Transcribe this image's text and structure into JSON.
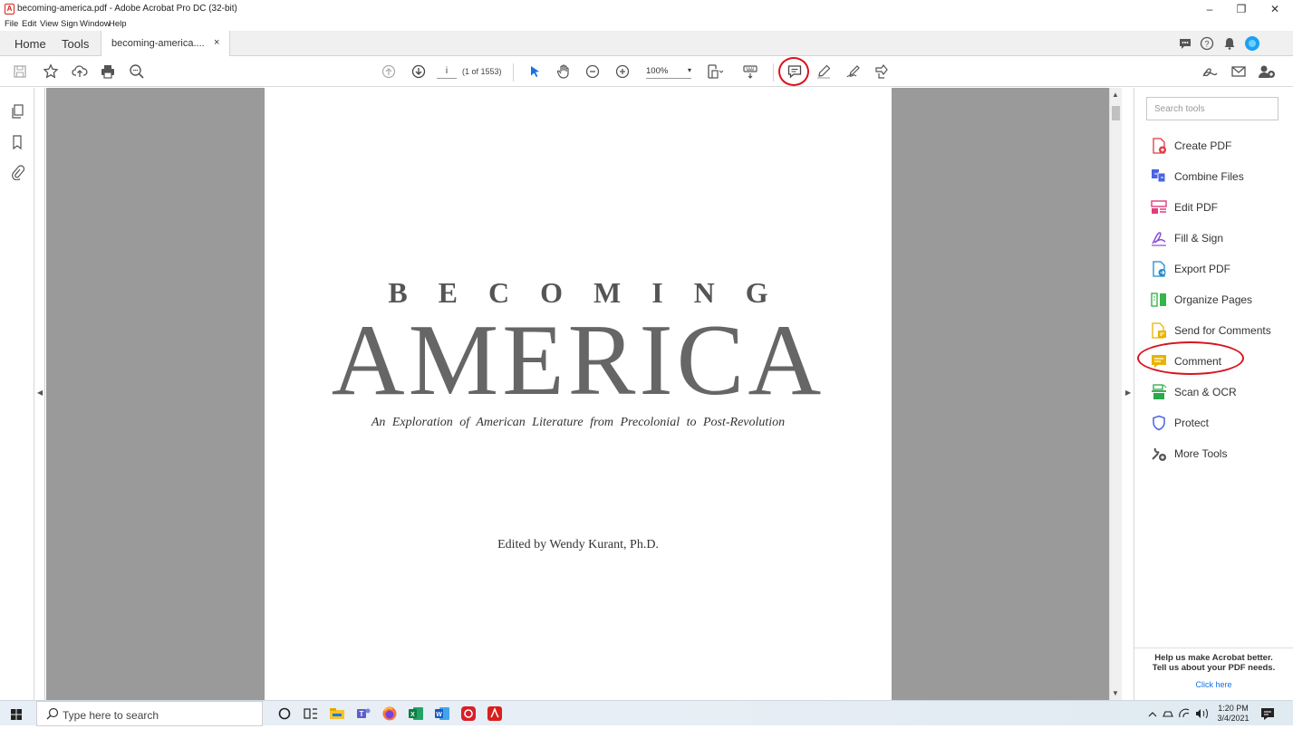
{
  "window": {
    "title": "becoming-america.pdf - Adobe Acrobat Pro DC (32-bit)",
    "controls": {
      "minimize": "–",
      "maximize": "❐",
      "close": "✕"
    }
  },
  "menu": [
    "File",
    "Edit",
    "View",
    "Sign",
    "Window",
    "Help"
  ],
  "tabs": {
    "home": "Home",
    "tools": "Tools",
    "document": "becoming-america....",
    "close": "×"
  },
  "toolbar": {
    "page_value": "i",
    "page_count": "(1 of 1553)",
    "zoom": "100%",
    "zoom_arrow": "▾"
  },
  "document": {
    "line1": "BECOMING",
    "line2": "AMERICA",
    "subtitle": "An Exploration of American Literature from Precolonial to Post-Revolution",
    "editor": "Edited by Wendy Kurant, Ph.D."
  },
  "tools_panel": {
    "search_placeholder": "Search tools",
    "items": [
      {
        "label": "Create PDF",
        "color": "#e0393e"
      },
      {
        "label": "Combine Files",
        "color": "#4a63e0"
      },
      {
        "label": "Edit PDF",
        "color": "#e23d7a"
      },
      {
        "label": "Fill & Sign",
        "color": "#8a4dd6"
      },
      {
        "label": "Export PDF",
        "color": "#1f8ad0"
      },
      {
        "label": "Organize Pages",
        "color": "#35b54a"
      },
      {
        "label": "Send for Comments",
        "color": "#e8b400"
      },
      {
        "label": "Comment",
        "color": "#e8b400"
      },
      {
        "label": "Scan & OCR",
        "color": "#2aa84a"
      },
      {
        "label": "Protect",
        "color": "#4a63e0"
      },
      {
        "label": "More Tools",
        "color": "#555555"
      }
    ],
    "help_line1": "Help us make Acrobat better.",
    "help_line2": "Tell us about your PDF needs.",
    "click_here": "Click here"
  },
  "taskbar": {
    "search_placeholder": "Type here to search",
    "time": "1:20 PM",
    "date": "3/4/2021"
  },
  "colors": {
    "annotation_red": "#d7141f",
    "canvas_gray": "#9a9a9a",
    "accent_blue": "#1473e6"
  }
}
